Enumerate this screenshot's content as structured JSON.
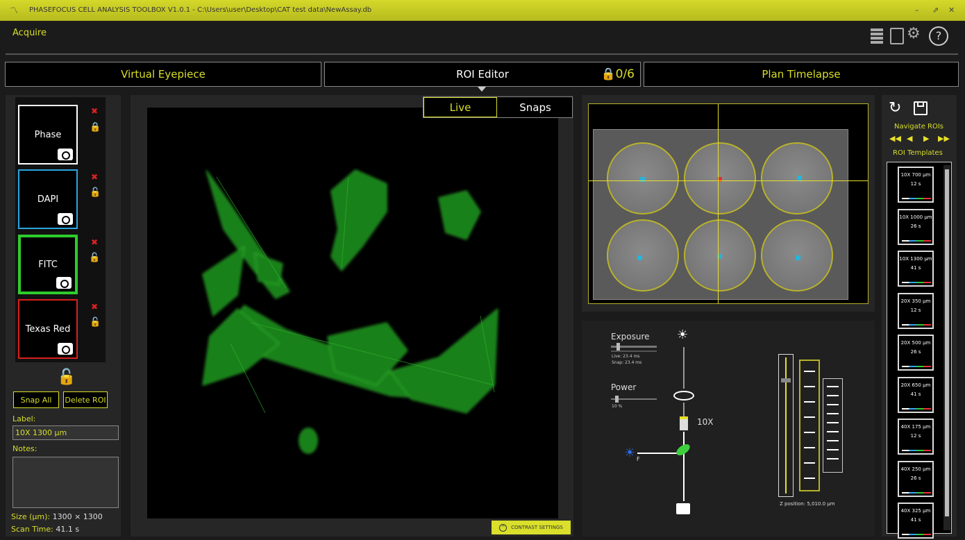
{
  "titlebar": {
    "text": "PHASEFOCUS CELL ANALYSIS TOOLBOX V1.0.1 - C:\\Users\\user\\Desktop\\CAT test data\\NewAssay.db",
    "min": "–",
    "max": "⇗",
    "close": "✕"
  },
  "header": {
    "section": "Acquire"
  },
  "tabs": [
    {
      "label": "Virtual Eyepiece"
    },
    {
      "label": "ROI Editor",
      "badge": "0/6"
    },
    {
      "label": "Plan Timelapse"
    }
  ],
  "view_toggle": {
    "live": "Live",
    "snaps": "Snaps"
  },
  "channels": [
    {
      "label": "Phase",
      "color": "#ffffff"
    },
    {
      "label": "DAPI",
      "color": "#2aa6e0"
    },
    {
      "label": "FITC",
      "color": "#2ecc2e"
    },
    {
      "label": "Texas Red",
      "color": "#d92020"
    }
  ],
  "buttons": {
    "snap_all": "Snap All",
    "delete_roi": "Delete ROI"
  },
  "form": {
    "label_caption": "Label:",
    "label_value": "10X 1300 µm",
    "notes_caption": "Notes:",
    "size_caption": "Size (µm):",
    "size_value": "1300 × 1300",
    "scan_caption": "Scan Time:",
    "scan_value": "41.1 s"
  },
  "contrast": "CONTRAST SETTINGS",
  "exposure": {
    "title": "Exposure",
    "live": "Live: 23.4 ms",
    "snap": "Snap: 23.4 ms",
    "level": 0.15
  },
  "power": {
    "title": "Power",
    "value": "10 %",
    "level": 0.1
  },
  "objective": "10X",
  "filter_label": "F",
  "z_position": "Z position: 5,010.0 µm",
  "nav": {
    "title": "Navigate ROIs",
    "templates_title": "ROI Templates"
  },
  "templates": [
    {
      "name": "10X 700 µm",
      "time": "12 s"
    },
    {
      "name": "10X 1000 µm",
      "time": "26 s"
    },
    {
      "name": "10X 1300 µm",
      "time": "41 s"
    },
    {
      "name": "20X 350 µm",
      "time": "12 s"
    },
    {
      "name": "20X 500 µm",
      "time": "26 s"
    },
    {
      "name": "20X 650 µm",
      "time": "41 s"
    },
    {
      "name": "40X 175 µm",
      "time": "12 s"
    },
    {
      "name": "40X 250 µm",
      "time": "26 s"
    },
    {
      "name": "40X 325 µm",
      "time": "41 s"
    }
  ],
  "accent": "#d9df2a"
}
